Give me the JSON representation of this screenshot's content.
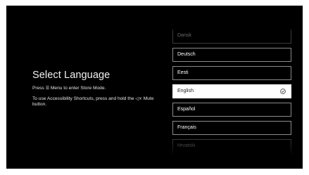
{
  "screen": {
    "title": "Select Language",
    "store_mode_hint_prefix": "Press ",
    "menu_glyph": "☰",
    "store_mode_hint_suffix": " Menu to enter Store Mode.",
    "accessibility_hint_prefix": "To use Accessibility Shortcuts, press and hold the ",
    "mute_glyph": "◁×",
    "accessibility_hint_suffix": " Mute button."
  },
  "languages": [
    {
      "label": "Dansk"
    },
    {
      "label": "Deutsch"
    },
    {
      "label": "Eesti"
    },
    {
      "label": "English",
      "selected": true,
      "icon": "check-circle-icon"
    },
    {
      "label": "Español"
    },
    {
      "label": "Français"
    },
    {
      "label": "Hrvatski"
    }
  ],
  "colors": {
    "background": "#000000",
    "selected_bg": "#ffffff",
    "selected_text": "#1a1a1a",
    "item_border": "#8a8a8a"
  }
}
